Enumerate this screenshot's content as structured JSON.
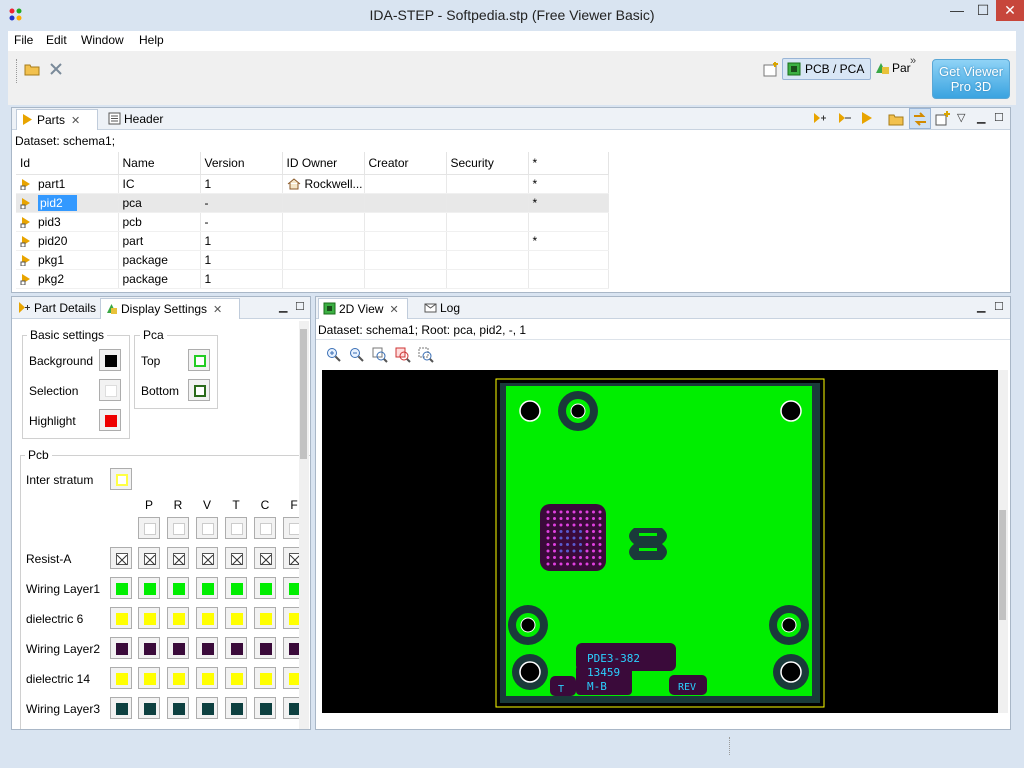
{
  "window": {
    "title": "IDA-STEP - Softpedia.stp (Free Viewer Basic)",
    "min": "—",
    "max": "☐",
    "close": "✕"
  },
  "menu": [
    "File",
    "Edit",
    "Window",
    "Help"
  ],
  "toolbar": {
    "perspective_pcb": "PCB / PCA",
    "perspective_part": "Par",
    "more": "»",
    "get_viewer_line1": "Get Viewer",
    "get_viewer_line2": "Pro 3D"
  },
  "parts_panel": {
    "tabs": [
      {
        "label": "Parts",
        "active": true
      },
      {
        "label": "Header",
        "active": false
      }
    ],
    "dataset": "Dataset: schema1;",
    "columns": [
      "Id",
      "Name",
      "Version",
      "ID Owner",
      "Creator",
      "Security",
      "*"
    ],
    "rows": [
      {
        "id": "part1",
        "name": "IC",
        "version": "1",
        "owner": "Rockwell...",
        "creator": "",
        "security": "",
        "star": "*"
      },
      {
        "id": "pid2",
        "name": "pca",
        "version": "-",
        "owner": "",
        "creator": "",
        "security": "",
        "star": "*"
      },
      {
        "id": "pid3",
        "name": "pcb",
        "version": "-",
        "owner": "",
        "creator": "",
        "security": "",
        "star": ""
      },
      {
        "id": "pid20",
        "name": "part",
        "version": "1",
        "owner": "",
        "creator": "",
        "security": "",
        "star": "*"
      },
      {
        "id": "pkg1",
        "name": "package",
        "version": "1",
        "owner": "",
        "creator": "",
        "security": "",
        "star": ""
      },
      {
        "id": "pkg2",
        "name": "package",
        "version": "1",
        "owner": "",
        "creator": "",
        "security": "",
        "star": ""
      }
    ]
  },
  "settings_panel": {
    "tabs": [
      {
        "label": "Part Details",
        "active": false
      },
      {
        "label": "Display Settings",
        "active": true
      }
    ],
    "basic": {
      "title": "Basic settings",
      "items": [
        {
          "label": "Background",
          "color": "#000000"
        },
        {
          "label": "Selection",
          "color": "#ffffff"
        },
        {
          "label": "Highlight",
          "color": "#ee0000"
        }
      ]
    },
    "pca": {
      "title": "Pca",
      "items": [
        {
          "label": "Top",
          "color": "#22cc22"
        },
        {
          "label": "Bottom",
          "color": "#2a6a1a"
        }
      ]
    },
    "pcb": {
      "title": "Pcb",
      "inter_stratum_label": "Inter stratum",
      "inter_stratum_color": "#ffff44",
      "columns": [
        "P",
        "R",
        "V",
        "T",
        "C",
        "F"
      ],
      "layers": [
        {
          "label": "",
          "color": "none"
        },
        {
          "label": "Resist-A",
          "color": "cross"
        },
        {
          "label": "Wiring Layer1",
          "color": "#00ee00"
        },
        {
          "label": "dielectric 6",
          "color": "#ffff00"
        },
        {
          "label": "Wiring Layer2",
          "color": "#3a0a3a"
        },
        {
          "label": "dielectric 14",
          "color": "#ffff00"
        },
        {
          "label": "Wiring Layer3",
          "color": "#0d4040"
        }
      ]
    }
  },
  "view_panel": {
    "tabs": [
      {
        "label": "2D View",
        "active": true
      },
      {
        "label": "Log",
        "active": false
      }
    ],
    "dataset": "Dataset: schema1; Root: pca, pid2, -, 1",
    "board_labels": [
      "PDE3-382",
      "13459",
      "M-B",
      "REV",
      "T"
    ]
  }
}
